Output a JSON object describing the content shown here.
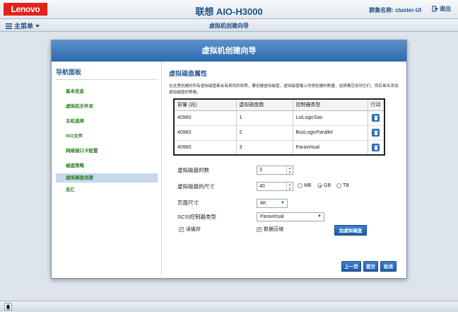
{
  "header": {
    "logo": "Lenovo",
    "app_title": "联想 AIO-H3000",
    "cluster_label": "群集名称: cluster-UI",
    "logout": "退出"
  },
  "menubar": {
    "main_menu": "主菜单",
    "crumb": "虚拟机创建向导"
  },
  "dialog": {
    "title": "虚拟机创建向导",
    "nav": {
      "header": "导航面板",
      "items": [
        "基本信息",
        "虚拟机文件夹",
        "主机选择",
        "ISO文件",
        "网络接口卡配置",
        "磁盘策略",
        "虚拟磁盘创建",
        "总汇"
      ],
      "active_index": 6
    },
    "content": {
      "section_title": "虚拟磁盘属性",
      "description": "在这里创建的所有虚拟磁盘都会有相同的政策。要创建虚拟磁盘，虚拟磁盘输入你想创建的数量，选择要应用到它们，然后单击添加虚拟磁盘的策略。",
      "table": {
        "headers": [
          "容量 (兆)",
          "虚拟磁盘数",
          "控制器类型",
          "行动"
        ],
        "rows": [
          [
            "40960",
            "1",
            "LsiLogicSas"
          ],
          [
            "40960",
            "2",
            "BusLogicParallel"
          ],
          [
            "40960",
            "3",
            "Paravirtual"
          ]
        ]
      },
      "form": {
        "disk_count_label": "虚拟磁盘的数",
        "disk_count_value": "3",
        "disk_size_label": "虚拟磁盘的尺寸",
        "disk_size_value": "40",
        "units": [
          "MB",
          "GB",
          "TB"
        ],
        "selected_unit": "GB",
        "page_size_label": "页面尺寸",
        "page_size_value": "4K",
        "scsi_label": "SCSI控制器类型",
        "scsi_value": "Paravirtual",
        "read_cache_label": "读缓存",
        "read_cache_checked": true,
        "compression_label": "数据压缩",
        "compression_checked": true,
        "add_disk_button": "加虚拟磁盘"
      },
      "buttons": {
        "prev": "上一页",
        "submit": "提交",
        "cancel": "取消"
      }
    }
  },
  "colors": {
    "accent": "#2e6aae",
    "logo_red": "#e2231a",
    "nav_green": "#2b7d1e"
  }
}
